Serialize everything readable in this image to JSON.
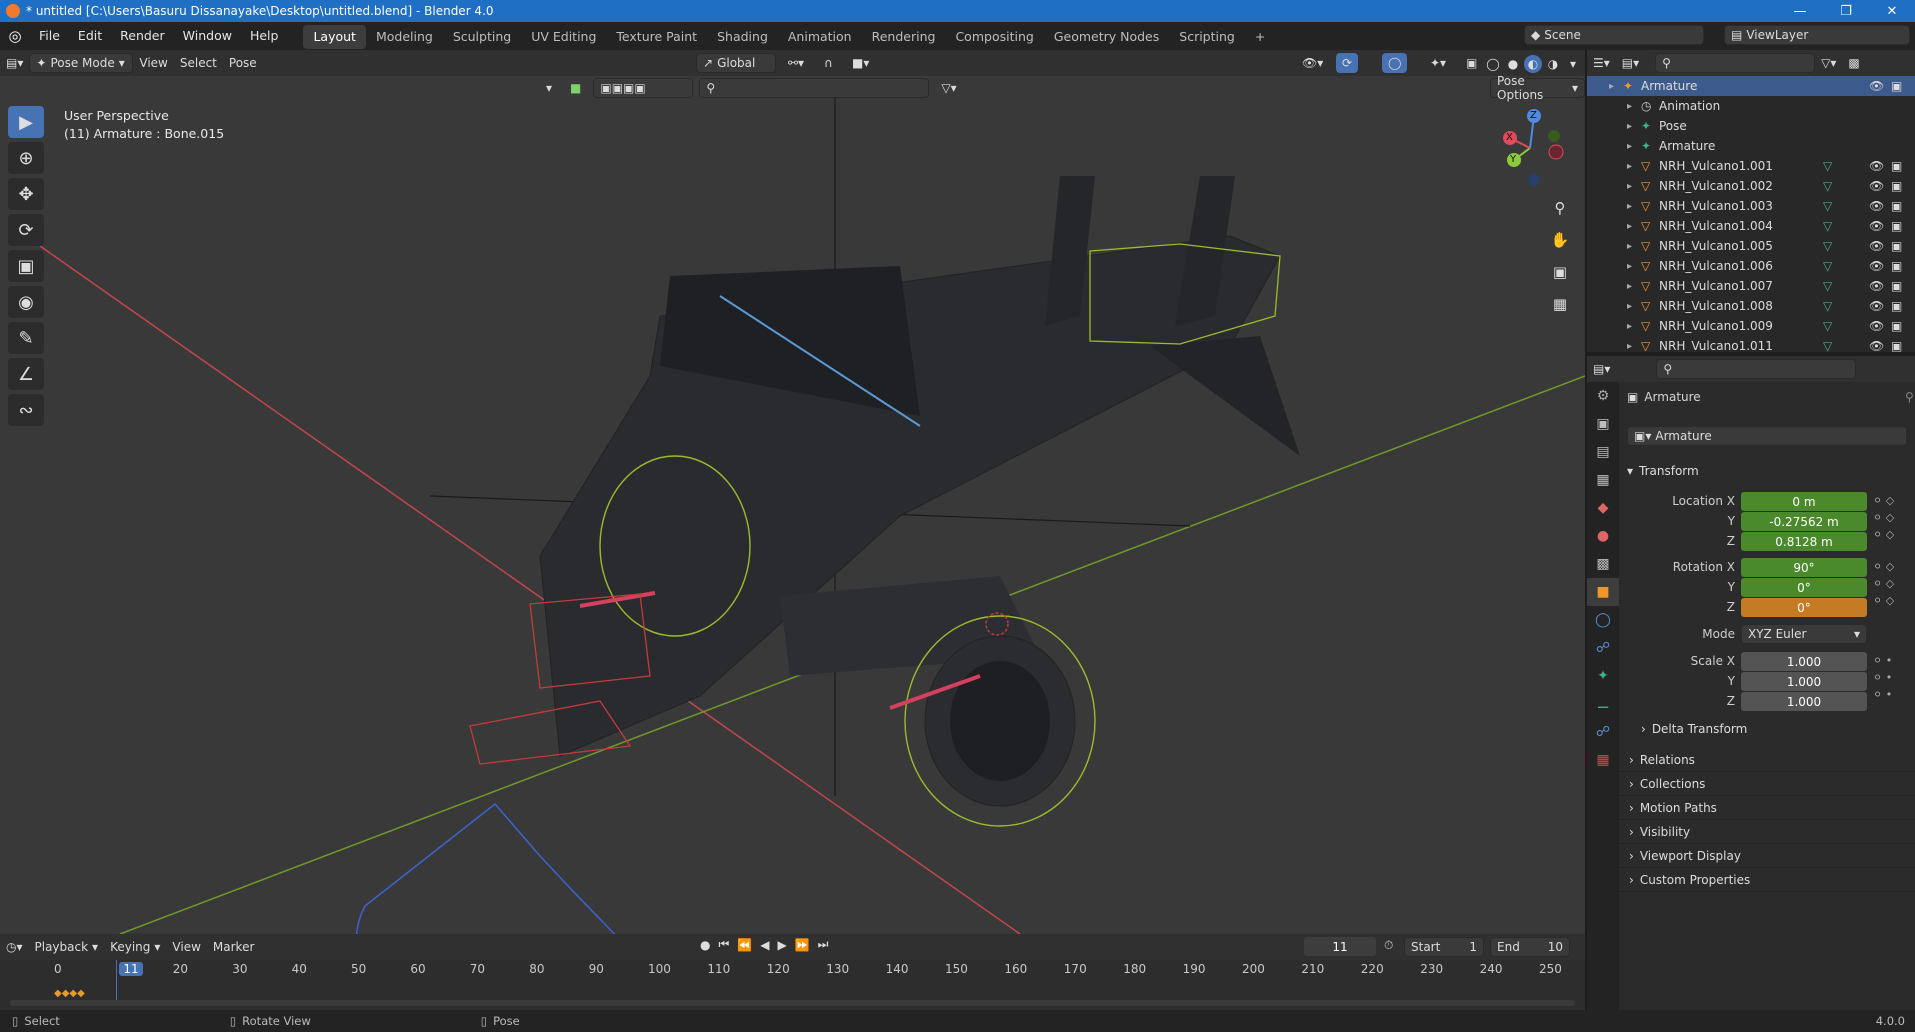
{
  "window": {
    "title": "* untitled [C:\\Users\\Basuru Dissanayake\\Desktop\\untitled.blend] - Blender 4.0",
    "minimize": "—",
    "maximize": "❐",
    "close": "✕"
  },
  "menu": [
    "File",
    "Edit",
    "Render",
    "Window",
    "Help"
  ],
  "workspaces": [
    "Layout",
    "Modeling",
    "Sculpting",
    "UV Editing",
    "Texture Paint",
    "Shading",
    "Animation",
    "Rendering",
    "Compositing",
    "Geometry Nodes",
    "Scripting"
  ],
  "add_workspace": "+",
  "scene": {
    "label": "Scene",
    "viewlayer": "ViewLayer"
  },
  "viewport_header": {
    "mode": "Pose Mode",
    "menus": [
      "View",
      "Select",
      "Pose"
    ],
    "orientation": "Global",
    "pose_options": "Pose Options"
  },
  "viewport": {
    "perspective": "User Perspective",
    "context": "(11) Armature : Bone.015",
    "axis_x": "X",
    "axis_y": "Y",
    "axis_z": "Z"
  },
  "tools": [
    "select-box",
    "cursor",
    "move",
    "rotate",
    "scale",
    "transform",
    "annotate",
    "measure",
    "bone-envelope"
  ],
  "outliner": {
    "rows": [
      {
        "label": "Armature",
        "indent": 0,
        "selected": true,
        "kind": "armature",
        "eye": true
      },
      {
        "label": "Animation",
        "indent": 1,
        "selected": false,
        "kind": "animation",
        "eye": false
      },
      {
        "label": "Pose",
        "indent": 1,
        "selected": false,
        "kind": "pose",
        "eye": false
      },
      {
        "label": "Armature",
        "indent": 1,
        "selected": false,
        "kind": "armature-data",
        "eye": false
      },
      {
        "label": "NRH_Vulcano1.001",
        "indent": 1,
        "selected": false,
        "kind": "mesh",
        "eye": true
      },
      {
        "label": "NRH_Vulcano1.002",
        "indent": 1,
        "selected": false,
        "kind": "mesh",
        "eye": true
      },
      {
        "label": "NRH_Vulcano1.003",
        "indent": 1,
        "selected": false,
        "kind": "mesh",
        "eye": true
      },
      {
        "label": "NRH_Vulcano1.004",
        "indent": 1,
        "selected": false,
        "kind": "mesh",
        "eye": true
      },
      {
        "label": "NRH_Vulcano1.005",
        "indent": 1,
        "selected": false,
        "kind": "mesh",
        "eye": true
      },
      {
        "label": "NRH_Vulcano1.006",
        "indent": 1,
        "selected": false,
        "kind": "mesh",
        "eye": true
      },
      {
        "label": "NRH_Vulcano1.007",
        "indent": 1,
        "selected": false,
        "kind": "mesh",
        "eye": true
      },
      {
        "label": "NRH_Vulcano1.008",
        "indent": 1,
        "selected": false,
        "kind": "mesh",
        "eye": true
      },
      {
        "label": "NRH_Vulcano1.009",
        "indent": 1,
        "selected": false,
        "kind": "mesh",
        "eye": true
      },
      {
        "label": "NRH_Vulcano1.011",
        "indent": 1,
        "selected": false,
        "kind": "mesh",
        "eye": true
      }
    ]
  },
  "properties": {
    "object_name": "Armature",
    "datablock": "Armature",
    "transform_title": "Transform",
    "location": {
      "label": "Location X",
      "x": "0 m",
      "y": "-0.27562 m",
      "z": "0.8128 m"
    },
    "rotation": {
      "label": "Rotation X",
      "x": "90°",
      "y": "0°",
      "z": "0°"
    },
    "mode": {
      "label": "Mode",
      "value": "XYZ Euler"
    },
    "scale": {
      "label": "Scale X",
      "x": "1.000",
      "y": "1.000",
      "z": "1.000"
    },
    "axis_y": "Y",
    "axis_z": "Z",
    "delta": "Delta Transform",
    "panels": [
      "Relations",
      "Collections",
      "Motion Paths",
      "Visibility",
      "Viewport Display",
      "Custom Properties"
    ]
  },
  "timeline": {
    "menus": [
      "Playback",
      "Keying",
      "View",
      "Marker"
    ],
    "current_frame": "11",
    "start_label": "Start",
    "start": "1",
    "end_label": "End",
    "end": "10",
    "ticks": [
      "0",
      "11",
      "20",
      "30",
      "40",
      "50",
      "60",
      "70",
      "80",
      "90",
      "100",
      "110",
      "120",
      "130",
      "140",
      "150",
      "160",
      "170",
      "180",
      "190",
      "200",
      "210",
      "220",
      "230",
      "240",
      "250"
    ]
  },
  "status": {
    "select": "Select",
    "rotate": "Rotate View",
    "pose": "Pose",
    "version": "4.0.0"
  },
  "colors": {
    "accent": "#4772b3",
    "location_field": "#4a8a2c",
    "rotation_field": "#4a8a2c",
    "rotation_keyed": "#c57a24",
    "axis_x": "#e04a5a",
    "axis_y": "#8ccc3a",
    "axis_z": "#4f8be0"
  }
}
